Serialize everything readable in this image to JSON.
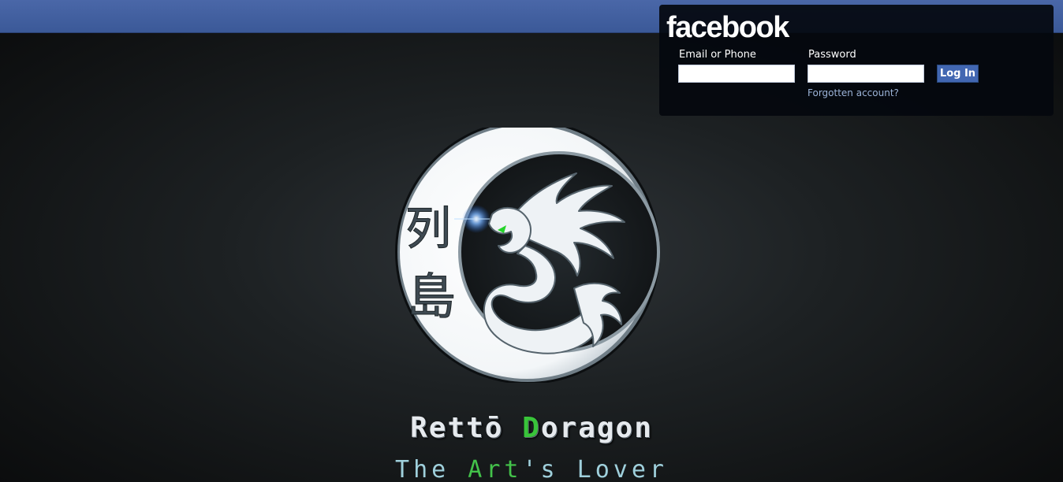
{
  "header": {
    "logo_text": "facebook",
    "brand_color": "#3b5998"
  },
  "login": {
    "email_label": "Email or Phone",
    "email_value": "",
    "password_label": "Password",
    "password_value": "",
    "login_button": "Log In",
    "forgot_link": "Forgotten account?"
  },
  "hero": {
    "kanji_top": "列",
    "kanji_bottom": "島",
    "brand_part1": "Rettō ",
    "brand_part2": "D",
    "brand_part3": "oragon",
    "tagline_part1": "The ",
    "tagline_part2": "Art",
    "tagline_part3": "'s Lover",
    "accent_color": "#39c43a",
    "icon": "dragon-icon"
  }
}
